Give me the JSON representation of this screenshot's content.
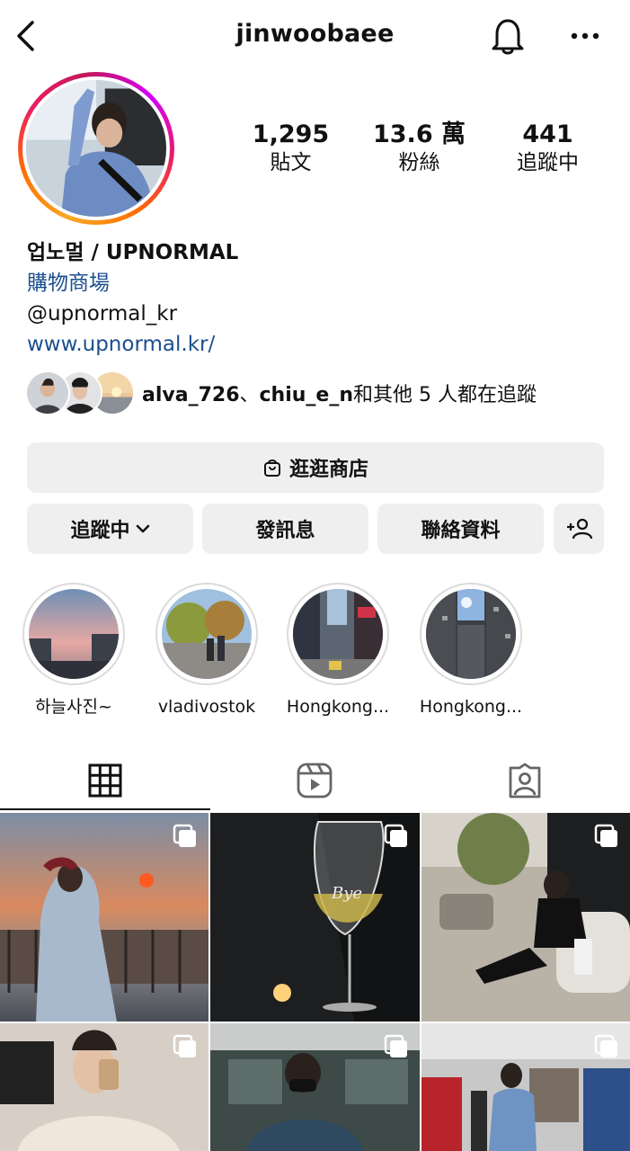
{
  "header": {
    "username": "jinwoobaee"
  },
  "profile": {
    "stats": [
      {
        "value": "1,295",
        "label": "貼文"
      },
      {
        "value": "13.6 萬",
        "label": "粉絲"
      },
      {
        "value": "441",
        "label": "追蹤中"
      }
    ],
    "name": "업노멀 / UPNORMAL",
    "category": "購物商場",
    "handle": "@upnormal_kr",
    "website": "www.upnormal.kr/"
  },
  "followed_by": {
    "user1": "alva_726",
    "separator": "、",
    "user2": "chiu_e_n",
    "suffix": "和其他 5 人都在追蹤"
  },
  "buttons": {
    "shop": "逛逛商店",
    "following": "追蹤中",
    "message": "發訊息",
    "contact": "聯絡資料"
  },
  "highlights": [
    {
      "label": "하늘사진~"
    },
    {
      "label": "vladivostok"
    },
    {
      "label": "Hongkong..."
    },
    {
      "label": "Hongkong..."
    }
  ],
  "tabs": [
    "grid-icon",
    "reels-icon",
    "tagged-icon"
  ],
  "colors": {
    "link": "#1c4f8f",
    "button_bg": "#efefef",
    "text": "#111111"
  }
}
